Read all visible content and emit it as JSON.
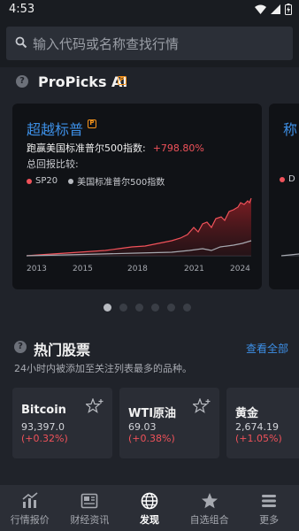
{
  "status": {
    "time": "4:53"
  },
  "search": {
    "placeholder": "输入代码或名称查找行情"
  },
  "propicks": {
    "title": "ProPicks AI",
    "card": {
      "title": "超越标普",
      "beat_text": "跑赢美国标准普尔500指数:",
      "gain": "+798.80%",
      "compare_label": "总回报比较:",
      "legend": [
        "SP20",
        "美国标准普尔500指数"
      ],
      "x_ticks": [
        "2013",
        "2015",
        "2018",
        "2021",
        "2024"
      ]
    },
    "next_card": {
      "title": "称",
      "legend_initial": "D"
    }
  },
  "hot": {
    "title": "热门股票",
    "view_all": "查看全部",
    "subtitle": "24小时内被添加至关注列表最多的品种。",
    "items": [
      {
        "name": "Bitcoin",
        "price": "93,397.0",
        "change": "(+0.32%)"
      },
      {
        "name": "WTI原油",
        "price": "69.03",
        "change": "(+0.38%)"
      },
      {
        "name": "黄金",
        "price": "2,674.19",
        "change": "(+1.05%)"
      }
    ]
  },
  "nav": [
    {
      "label": "行情报价",
      "icon": "chart-icon"
    },
    {
      "label": "财经资讯",
      "icon": "news-icon"
    },
    {
      "label": "发现",
      "icon": "globe-icon"
    },
    {
      "label": "自选组合",
      "icon": "star-icon"
    },
    {
      "label": "更多",
      "icon": "menu-icon"
    }
  ],
  "colors": {
    "accent": "#3d8fe6",
    "up": "#f0525a",
    "badge": "#f7931a"
  }
}
